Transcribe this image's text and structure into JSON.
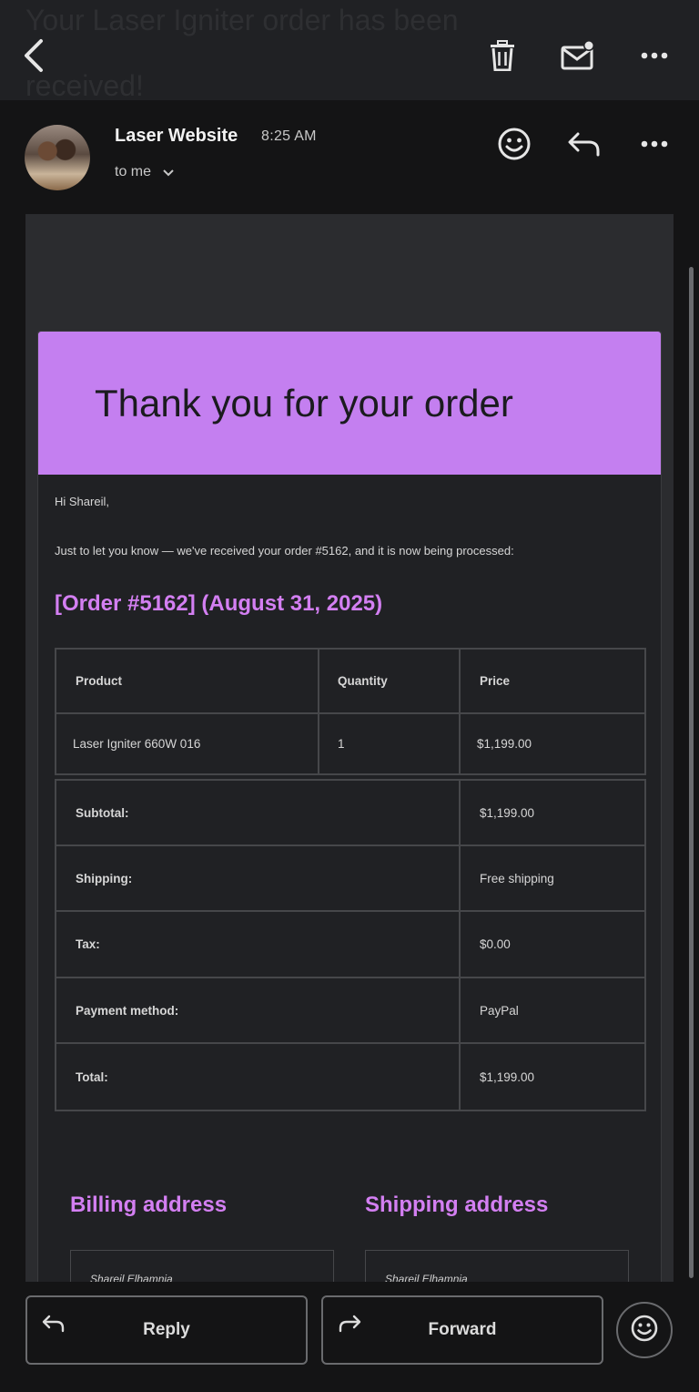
{
  "topbar": {
    "subject": "Your Laser Igniter order has been received!",
    "icons": [
      "back-arrow-icon",
      "trash-icon",
      "mark-unread-icon",
      "more-icon"
    ]
  },
  "sender": {
    "name": "Laser Website",
    "time": "8:25 AM",
    "recipient": "to me",
    "icons": [
      "avatar",
      "emoji-react-icon",
      "reply-icon",
      "more-icon"
    ]
  },
  "email": {
    "banner_title": "Thank you for your order",
    "greeting": "Hi Shareil,",
    "intro": "Just to let you know — we've received your order #5162, and it is now being processed:",
    "order_heading": "[Order #5162] (August 31, 2025)",
    "items_table": {
      "headers": [
        "Product",
        "Quantity",
        "Price"
      ],
      "rows": [
        {
          "product": "Laser Igniter 660W 016",
          "quantity": "1",
          "price": "$1,199.00"
        }
      ]
    },
    "totals": [
      {
        "label": "Subtotal:",
        "value": "$1,199.00"
      },
      {
        "label": "Shipping:",
        "value": "Free shipping"
      },
      {
        "label": "Tax:",
        "value": "$0.00"
      },
      {
        "label": "Payment method:",
        "value": "PayPal"
      },
      {
        "label": "Total:",
        "value": "$1,199.00"
      }
    ],
    "billing_title": "Billing address",
    "shipping_title": "Shipping address",
    "billing_name": "Shareil Elhamnia",
    "shipping_name": "Shareil Elhamnia"
  },
  "actions": {
    "reply": "Reply",
    "forward": "Forward"
  },
  "colors": {
    "accent": "#c47ff0",
    "heading": "#d37ff2",
    "background": "#141415",
    "card": "#202124"
  }
}
